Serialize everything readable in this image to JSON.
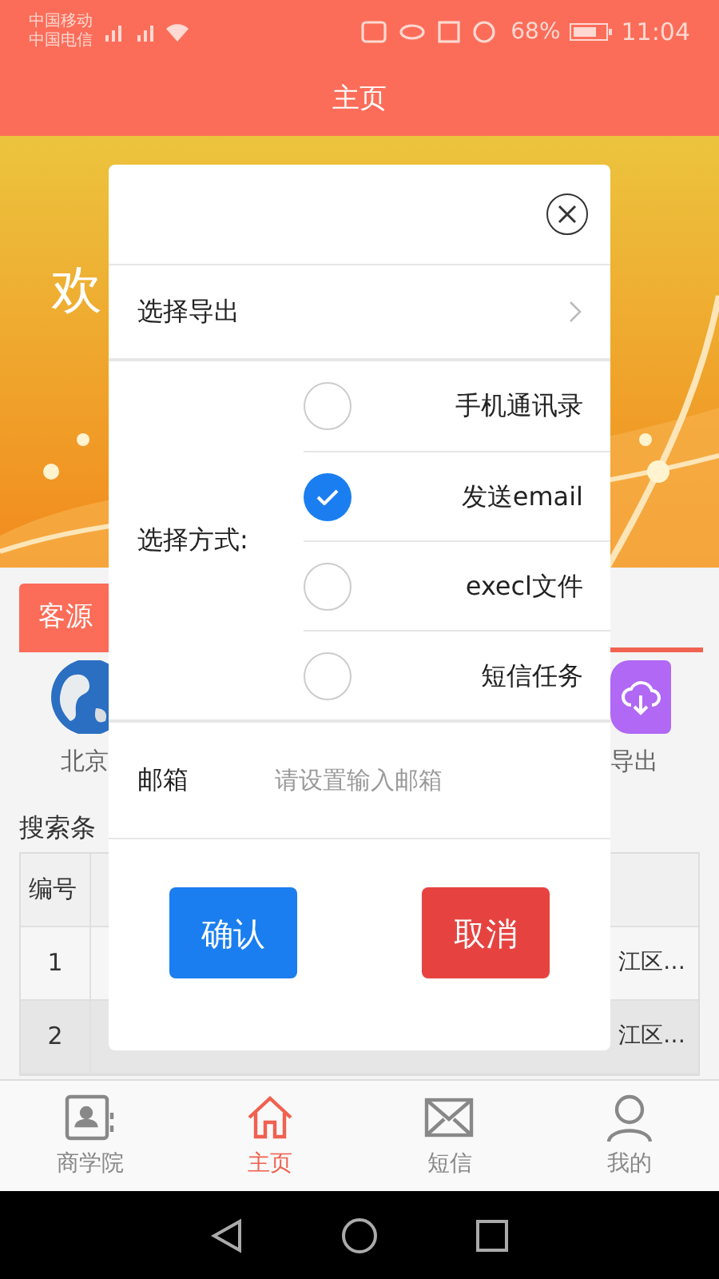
{
  "status_bar": {
    "carriers": [
      "中国移动",
      "中国电信"
    ],
    "battery": "68%",
    "time": "11:04"
  },
  "header": {
    "title": "主页"
  },
  "banner": {
    "kind": "picture",
    "text": "欢"
  },
  "tabs": [
    {
      "label": "客源",
      "selected": true
    }
  ],
  "shortcuts": [
    {
      "label": "北京",
      "kind": "globe"
    },
    {
      "label": "导出",
      "kind": "download"
    }
  ],
  "search_label": "搜索条",
  "table": {
    "header": [
      "编号"
    ],
    "rows": [
      {
        "number": "1",
        "address": "江区…"
      },
      {
        "number": "2",
        "address": "江区…"
      }
    ]
  },
  "bottom_nav": [
    {
      "label": "商学院",
      "kind": "contacts",
      "selected": false
    },
    {
      "label": "主页",
      "kind": "home",
      "selected": true
    },
    {
      "label": "短信",
      "kind": "mail",
      "selected": false
    },
    {
      "label": "我的",
      "kind": "user",
      "selected": false
    }
  ],
  "dialog": {
    "export_row": {
      "label": "选择导出"
    },
    "method_label": "选择方式:",
    "options": [
      {
        "label": "手机通讯录",
        "selected": false
      },
      {
        "label": "发送email",
        "selected": true
      },
      {
        "label": "execl文件",
        "selected": false
      },
      {
        "label": "短信任务",
        "selected": false
      }
    ],
    "email": {
      "label": "邮箱",
      "placeholder": "请设置输入邮箱"
    },
    "buttons": [
      {
        "label": "确认",
        "kind": "confirm"
      },
      {
        "label": "取消",
        "kind": "cancel"
      }
    ]
  }
}
